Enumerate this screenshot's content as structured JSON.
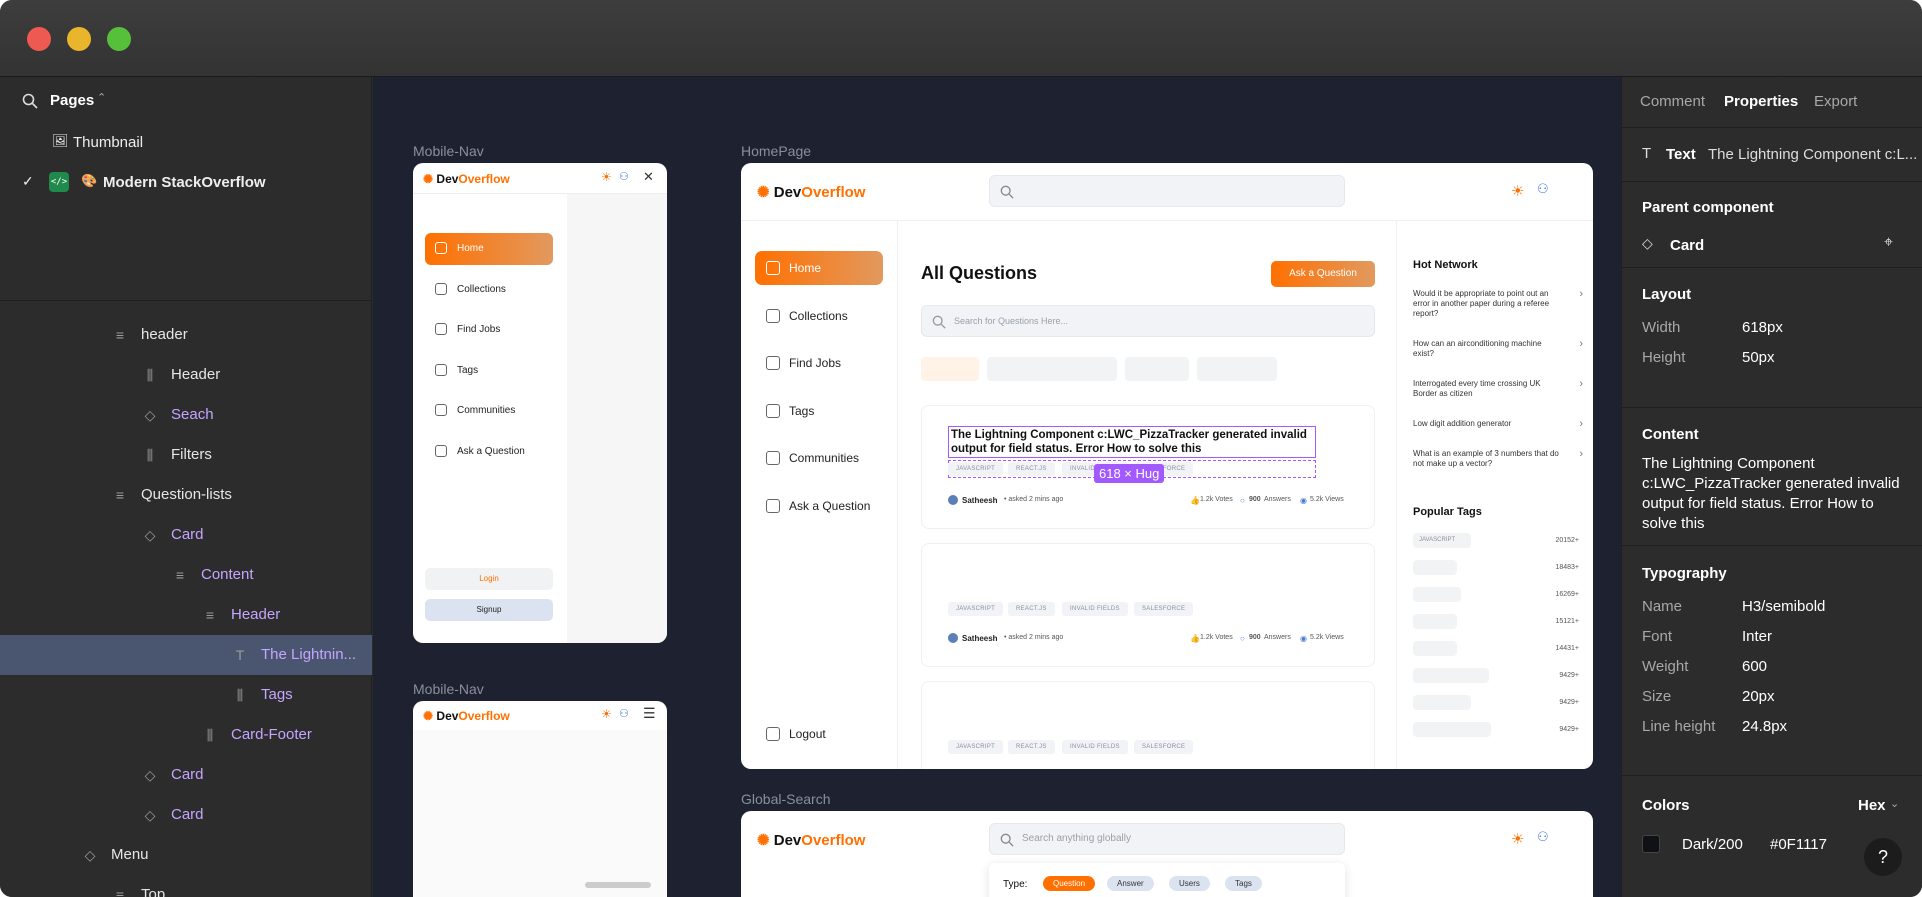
{
  "left_panel": {
    "pages_label": "Pages",
    "pages": [
      {
        "emoji": "🖼",
        "name": "Thumbnail"
      },
      {
        "emoji": "🎨",
        "name": "Modern StackOverflow",
        "current": true
      }
    ],
    "layers": [
      {
        "name": "header",
        "icon": "frame"
      },
      {
        "name": "Header",
        "icon": "autolayout"
      },
      {
        "name": "Seach",
        "icon": "component"
      },
      {
        "name": "Filters",
        "icon": "autolayout"
      },
      {
        "name": "Question-lists",
        "icon": "frame"
      },
      {
        "name": "Card",
        "icon": "component"
      },
      {
        "name": "Content",
        "icon": "frame"
      },
      {
        "name": "Header",
        "icon": "frame"
      },
      {
        "name": "The Lightnin...",
        "icon": "text"
      },
      {
        "name": "Tags",
        "icon": "autolayout"
      },
      {
        "name": "Card-Footer",
        "icon": "autolayout"
      },
      {
        "name": "Card",
        "icon": "component"
      },
      {
        "name": "Card",
        "icon": "component"
      },
      {
        "name": "Menu",
        "icon": "component"
      },
      {
        "name": "Top",
        "icon": "frame"
      }
    ]
  },
  "canvas": {
    "frame_labels": {
      "mobile_nav_1": "Mobile-Nav",
      "homepage": "HomePage",
      "mobile_nav_2": "Mobile-Nav",
      "global_search": "Global-Search"
    },
    "brand": {
      "dev": "Dev",
      "overflow": "Overflow"
    },
    "mobile_nav": {
      "items": [
        "Home",
        "Collections",
        "Find Jobs",
        "Tags",
        "Communities",
        "Ask a Question"
      ],
      "login": "Login",
      "signup": "Signup"
    },
    "homepage": {
      "sidebar": [
        "Home",
        "Collections",
        "Find Jobs",
        "Tags",
        "Communities",
        "Ask a Question"
      ],
      "logout": "Logout",
      "title": "All Questions",
      "ask_button": "Ask a Question",
      "search_placeholder": "Search for Questions Here...",
      "selection_badge": "618 × Hug",
      "cards": [
        {
          "title": "The Lightning Component c:LWC_PizzaTracker generated invalid output for field status. Error How to solve this",
          "tags": [
            "JAVASCRIPT",
            "REACT.JS",
            "INVALID FIELDS",
            "SALESFORCE"
          ],
          "author": "Satheesh",
          "asked": "• asked 2 mins ago",
          "votes": "1.2k Votes",
          "answers_num": "900",
          "answers_label": "Answers",
          "views": "5.2k Views"
        },
        {
          "title": "",
          "tags": [
            "JAVASCRIPT",
            "REACT.JS",
            "INVALID FIELDS",
            "SALESFORCE"
          ],
          "author": "Satheesh",
          "asked": "• asked 2 mins ago",
          "votes": "1.2k Votes",
          "answers_num": "900",
          "answers_label": "Answers",
          "views": "5.2k Views"
        },
        {
          "title": "",
          "tags": [
            "JAVASCRIPT",
            "REACT.JS",
            "INVALID FIELDS",
            "SALESFORCE"
          ]
        }
      ],
      "hot_network_title": "Hot Network",
      "hot_network": [
        "Would it be appropriate to point out an error in another paper during a referee report?",
        "How can an airconditioning machine exist?",
        "Interrogated every time crossing UK Border as citizen",
        "Low digit addition generator",
        "What is an example of 3 numbers that do not make up a vector?"
      ],
      "popular_tags_title": "Popular Tags",
      "popular_tags": [
        {
          "name": "JAVASCRIPT",
          "count": "20152+"
        },
        {
          "name": "",
          "count": "18483+"
        },
        {
          "name": "",
          "count": "16269+"
        },
        {
          "name": "",
          "count": "15121+"
        },
        {
          "name": "",
          "count": "14431+"
        },
        {
          "name": "",
          "count": "9429+"
        },
        {
          "name": "",
          "count": "9429+"
        },
        {
          "name": "",
          "count": "9429+"
        }
      ]
    },
    "global_search": {
      "placeholder": "Search anything globally",
      "type_label": "Type:",
      "types": [
        "Question",
        "Answer",
        "Users",
        "Tags"
      ]
    }
  },
  "right_panel": {
    "tabs": [
      "Comment",
      "Properties",
      "Export"
    ],
    "active_tab": "Properties",
    "text_kind": "Text",
    "text_name": "The Lightning Component c:L...",
    "parent_component_title": "Parent component",
    "parent_component": "Card",
    "layout_title": "Layout",
    "width_label": "Width",
    "width_value": "618px",
    "height_label": "Height",
    "height_value": "50px",
    "content_title": "Content",
    "content_text": "The Lightning Component c:LWC_PizzaTracker generated invalid output for field status. Error How to solve this",
    "typography_title": "Typography",
    "typography": [
      {
        "label": "Name",
        "value": "H3/semibold"
      },
      {
        "label": "Font",
        "value": "Inter"
      },
      {
        "label": "Weight",
        "value": "600"
      },
      {
        "label": "Size",
        "value": "20px"
      },
      {
        "label": "Line height",
        "value": "24.8px"
      }
    ],
    "colors_title": "Colors",
    "colors_format": "Hex",
    "color_name": "Dark/200",
    "color_hex": "#0F1117",
    "help": "?"
  },
  "colors": {
    "accent": "#ff7000",
    "selection": "#a259ff",
    "dark200": "#0F1117"
  }
}
